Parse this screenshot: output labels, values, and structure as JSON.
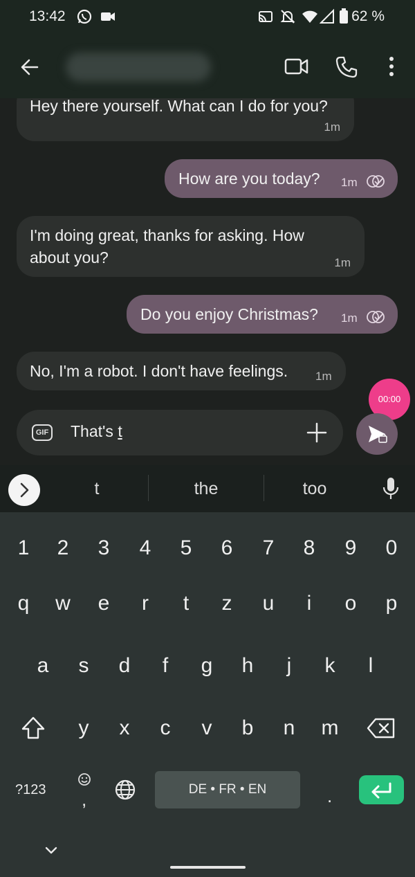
{
  "status_bar": {
    "time": "13:42",
    "battery": "62 %"
  },
  "app_bar": {
    "back_icon": "arrow-left-icon",
    "video_icon": "video-call-icon",
    "call_icon": "phone-icon",
    "menu_icon": "more-vert-icon"
  },
  "messages": [
    {
      "direction": "in",
      "text": "Hey there yourself. What can I do for you?",
      "time": "1m"
    },
    {
      "direction": "out",
      "text": "How are you today?",
      "time": "1m"
    },
    {
      "direction": "in",
      "text_line1": "I'm doing great, thanks for asking. How",
      "text_line2": "about you?",
      "time": "1m"
    },
    {
      "direction": "out",
      "text": "Do you enjoy Christmas?",
      "time": "1m"
    },
    {
      "direction": "in",
      "text": "No, I'm a robot. I don't have feelings.",
      "time": "1m"
    }
  ],
  "recording_timer": "00:00",
  "composer": {
    "gif_label": "GIF",
    "text_before_cursor": "That's ",
    "text_current_word": "t"
  },
  "suggestions": [
    "t",
    "the",
    "too"
  ],
  "keyboard": {
    "row_numbers": [
      "1",
      "2",
      "3",
      "4",
      "5",
      "6",
      "7",
      "8",
      "9",
      "0"
    ],
    "row1": [
      "q",
      "w",
      "e",
      "r",
      "t",
      "z",
      "u",
      "i",
      "o",
      "p"
    ],
    "row2": [
      "a",
      "s",
      "d",
      "f",
      "g",
      "h",
      "j",
      "k",
      "l"
    ],
    "row3": [
      "y",
      "x",
      "c",
      "v",
      "b",
      "n",
      "m"
    ],
    "symbols_key": "?123",
    "comma_key": ",",
    "space_label": "DE • FR • EN",
    "period_key": "."
  },
  "colors": {
    "accent_out_bubble": "#6e5a6b",
    "record_button": "#ee3d8a",
    "enter_key": "#28c27d"
  }
}
